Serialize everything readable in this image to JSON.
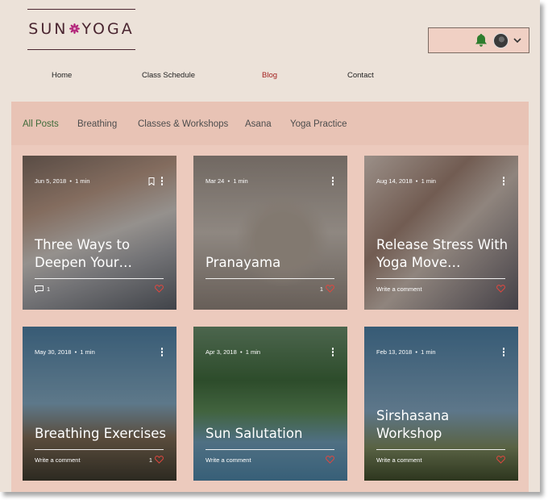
{
  "brand": {
    "logo_left": "SUN",
    "logo_right": "YOGA"
  },
  "user_menu": {
    "bell_icon": "bell-icon",
    "avatar": "avatar",
    "chevron_icon": "chevron-down-icon"
  },
  "nav": {
    "items": [
      "Home",
      "Class Schedule",
      "Blog",
      "Contact"
    ],
    "active_index": 2
  },
  "categories": {
    "items": [
      "All Posts",
      "Breathing",
      "Classes & Workshops",
      "Asana",
      "Yoga Practice"
    ],
    "active_index": 0
  },
  "posts": [
    {
      "date": "Jun 5, 2018",
      "read": "1 min",
      "title": "Three Ways to Deepen Your…",
      "comments": "1",
      "likes": "",
      "write": ""
    },
    {
      "date": "Mar 24",
      "read": "1 min",
      "title": "Pranayama",
      "comments": "",
      "likes": "1",
      "write": ""
    },
    {
      "date": "Aug 14, 2018",
      "read": "1 min",
      "title": "Release Stress With Yoga Move…",
      "comments": "",
      "likes": "",
      "write": "Write a comment"
    },
    {
      "date": "May 30, 2018",
      "read": "1 min",
      "title": "Breathing Exercises",
      "comments": "",
      "likes": "1",
      "write": "Write a comment"
    },
    {
      "date": "Apr 3, 2018",
      "read": "1 min",
      "title": "Sun Salutation",
      "comments": "",
      "likes": "",
      "write": "Write a comment"
    },
    {
      "date": "Feb 13, 2018",
      "read": "1 min",
      "title": "Sirshasana Workshop",
      "comments": "",
      "likes": "",
      "write": "Write a comment"
    }
  ],
  "colors": {
    "brand": "#4a2530",
    "flower": "#b3267a",
    "nav_active": "#a3211f",
    "category_active": "#3f6b3a",
    "bell": "#2e7d2e",
    "heart": "#e0473f",
    "header_bar": "#e8c3b5",
    "page_bg": "#ece2d9"
  }
}
